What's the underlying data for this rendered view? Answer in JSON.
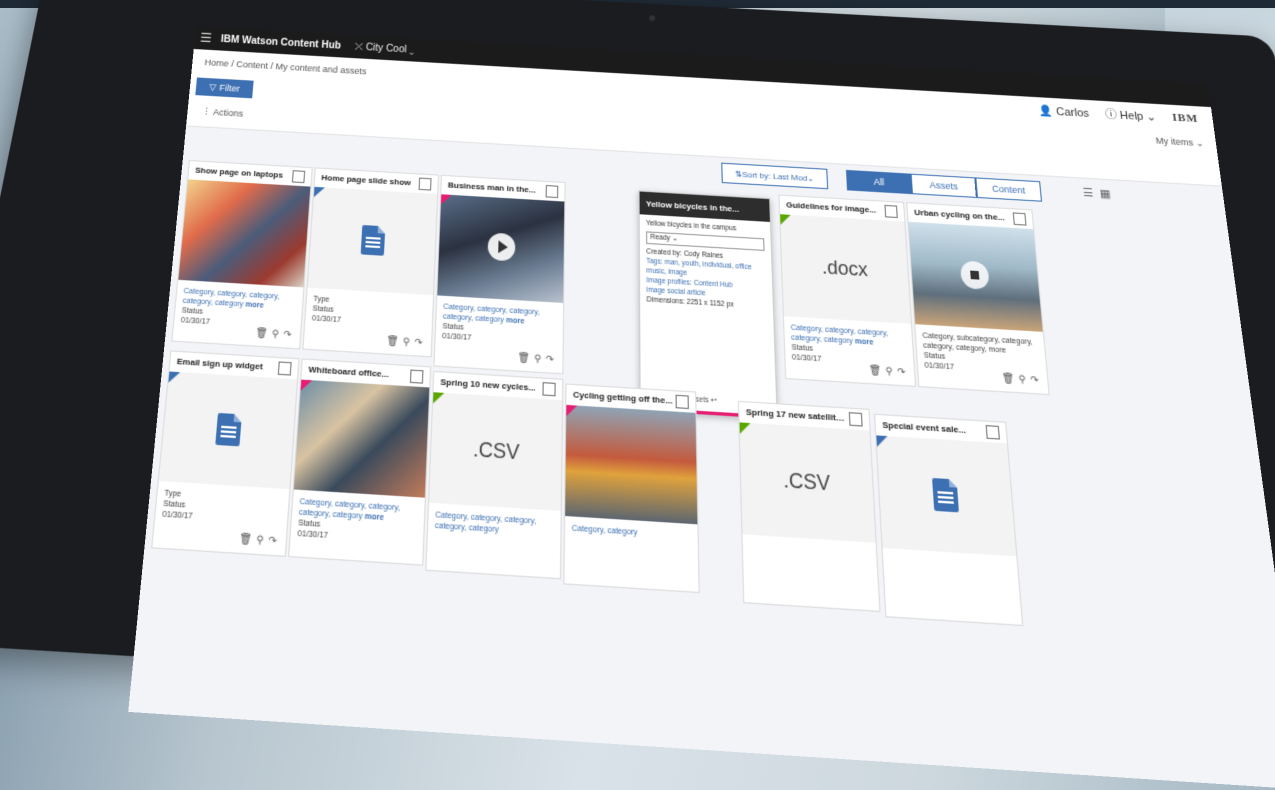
{
  "app": {
    "title": "IBM Watson Content Hub",
    "site": "City Cool",
    "user": "Carlos",
    "help": "Help",
    "brand": "IBM"
  },
  "breadcrumb": "Home / Content / My content and assets",
  "filter_label": "Filter",
  "my_items_label": "My items",
  "actions_label": "Actions",
  "sort_label": "Sort by: Last Mod",
  "segments": [
    "All",
    "Assets",
    "Content"
  ],
  "cards": [
    {
      "title": "Show page on laptops",
      "meta": "Category, category, category, category, category",
      "more": "more",
      "status": "Status",
      "date": "01/30/17"
    },
    {
      "title": "Home page slide show",
      "type": "Type",
      "status": "Status",
      "date": "01/30/17"
    },
    {
      "title": "Business man in the...",
      "meta": "Category, category, category, category, category",
      "more": "more",
      "status": "Status",
      "date": "01/30/17"
    },
    {
      "title": "Guidelines for image...",
      "ext": ".docx",
      "meta": "Category, category, category, category, category",
      "more": "more",
      "status": "Status",
      "date": "01/30/17"
    },
    {
      "title": "Urban cycling on the...",
      "meta": "Category, subcategory, category, category, category, more",
      "status": "Status",
      "date": "01/30/17"
    },
    {
      "title": "Email sign up widget",
      "type": "Type",
      "status": "Status",
      "date": "01/30/17"
    },
    {
      "title": "Whiteboard office...",
      "meta": "Category, category, category, category, category",
      "more": "more",
      "status": "Status",
      "date": "01/30/17"
    },
    {
      "title": "Spring 10 new cycles...",
      "ext": ".CSV",
      "meta": "Category, category, category, category, category"
    },
    {
      "title": "Cycling getting off the...",
      "meta": "Category, category"
    },
    {
      "title": "Spring 17 new satellites...",
      "ext": ".CSV"
    },
    {
      "title": "Special event sale..."
    }
  ],
  "popup": {
    "title": "Yellow bicycles in the...",
    "line1": "Yellow bicycles in the campus",
    "select": "Ready",
    "created_by": "Created by: Cody Raines",
    "tags": "Tags: man, youth, individual, office",
    "tags2": "music, image",
    "image_profiles": "Image profiles: Content Hub",
    "image_profiles2": "image social article",
    "dimensions": "Dimensions: 2251 x 1152 px",
    "footer": "View related assets"
  },
  "colors": {
    "accent": "#3d70b2",
    "appbar": "#1b1b1b",
    "pink": "#e71d72",
    "green": "#5aa700"
  }
}
